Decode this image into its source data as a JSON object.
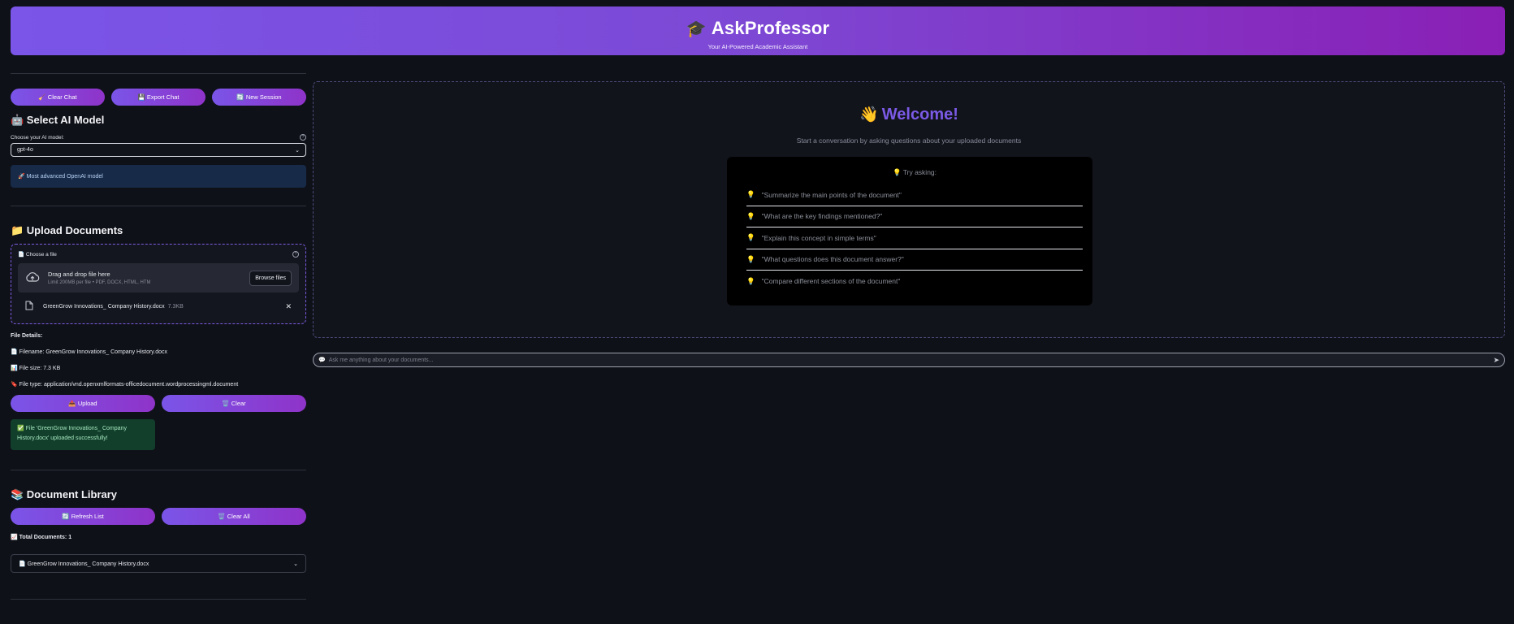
{
  "header": {
    "icon": "🎓",
    "title": "AskProfessor",
    "subtitle": "Your AI-Powered Academic Assistant"
  },
  "actions": {
    "clear_chat": "🧹 Clear Chat",
    "export_chat": "💾 Export Chat",
    "new_session": "🔄 New Session"
  },
  "model": {
    "section_title": "🤖 Select AI Model",
    "label": "Choose your AI model:",
    "selected": "gpt-4o",
    "info": "🚀 Most advanced OpenAI model"
  },
  "upload": {
    "section_title": "📁 Upload Documents",
    "choose_label": "📄 Choose a file",
    "drop_title": "Drag and drop file here",
    "drop_limit": "Limit 200MB per file • PDF, DOCX, HTML, HTM",
    "browse": "Browse files",
    "file_name": "GreenGrow Innovations_ Company History.docx",
    "file_size": "7.3KB"
  },
  "file_details": {
    "heading": "File Details:",
    "filename": "📄 Filename: GreenGrow Innovations_ Company History.docx",
    "filesize": "📊 File size: 7.3 KB",
    "filetype": "🔖 File type: application/vnd.openxmlformats-officedocument.wordprocessingml.document",
    "upload_btn": "📤 Upload",
    "clear_btn": "🗑️ Clear",
    "success": "✅ File 'GreenGrow Innovations_ Company History.docx' uploaded successfully!"
  },
  "library": {
    "section_title": "📚 Document Library",
    "refresh": "🔄 Refresh List",
    "clear_all": "🗑️ Clear All",
    "total": "📈 Total Documents: 1",
    "doc": "📄 GreenGrow Innovations_ Company History.docx"
  },
  "welcome": {
    "icon": "👋",
    "title": "Welcome!",
    "subtitle": "Start a conversation by asking questions about your uploaded documents",
    "try_title": "💡 Try asking:",
    "suggestions": [
      "\"Summarize the main points of the document\"",
      "\"What are the key findings mentioned?\"",
      "\"Explain this concept in simple terms\"",
      "\"What questions does this document answer?\"",
      "\"Compare different sections of the document\""
    ]
  },
  "chat": {
    "placeholder": "Ask me anything about your documents..."
  }
}
